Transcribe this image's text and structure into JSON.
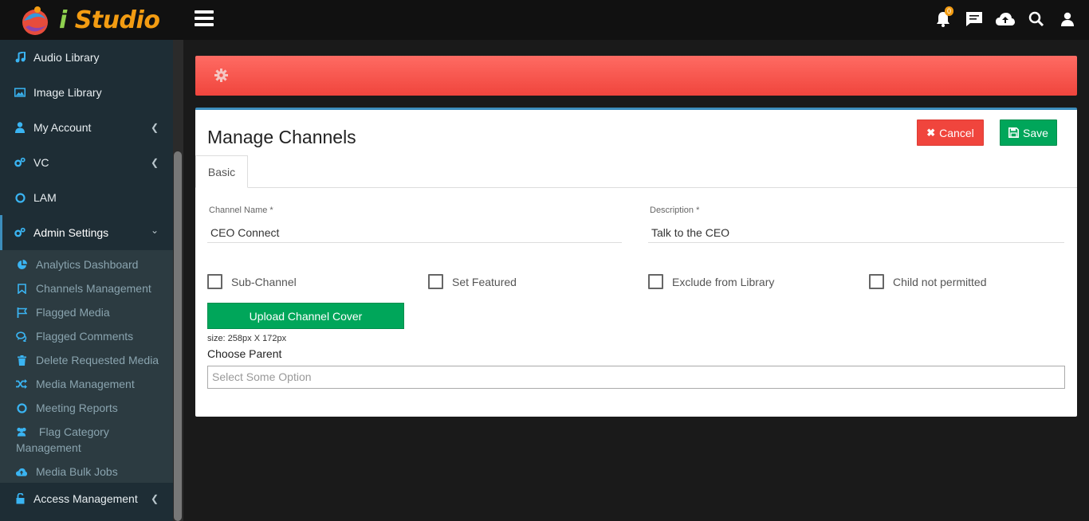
{
  "app": {
    "logo_prefix": "i",
    "logo_name": "Studio"
  },
  "topbar": {
    "notification_count": "0"
  },
  "sidebar": {
    "items": [
      {
        "label": "Audio Library"
      },
      {
        "label": "Image Library"
      },
      {
        "label": "My Account"
      },
      {
        "label": "VC"
      },
      {
        "label": "LAM"
      },
      {
        "label": "Admin Settings"
      }
    ],
    "submenu": [
      {
        "label": "Analytics Dashboard"
      },
      {
        "label": "Channels Management"
      },
      {
        "label": "Flagged Media"
      },
      {
        "label": "Flagged Comments"
      },
      {
        "label": "Delete Requested Media"
      },
      {
        "label": "Media Management"
      },
      {
        "label": "Meeting Reports"
      },
      {
        "label": "Flag Category Management"
      },
      {
        "label": "Media Bulk Jobs"
      }
    ],
    "bottom_item": {
      "label": "Access Management"
    }
  },
  "panel": {
    "title": "Manage Channels",
    "cancel_label": "Cancel",
    "save_label": "Save",
    "tab_label": "Basic",
    "channel_name_label": "Channel Name *",
    "channel_name_value": "CEO Connect",
    "description_label": "Description *",
    "description_value": "Talk to the CEO",
    "checkboxes": [
      {
        "label": "Sub-Channel"
      },
      {
        "label": "Set Featured"
      },
      {
        "label": "Exclude from Library"
      },
      {
        "label": "Child not permitted"
      }
    ],
    "upload_label": "Upload Channel Cover",
    "size_note": "size: 258px X 172px",
    "choose_parent_label": "Choose Parent",
    "select_placeholder": "Select Some Option"
  },
  "colors": {
    "accent": "#3c8dbc",
    "danger": "#f0453d",
    "success": "#00a65a",
    "sidebar_bg": "#1e2d35"
  }
}
